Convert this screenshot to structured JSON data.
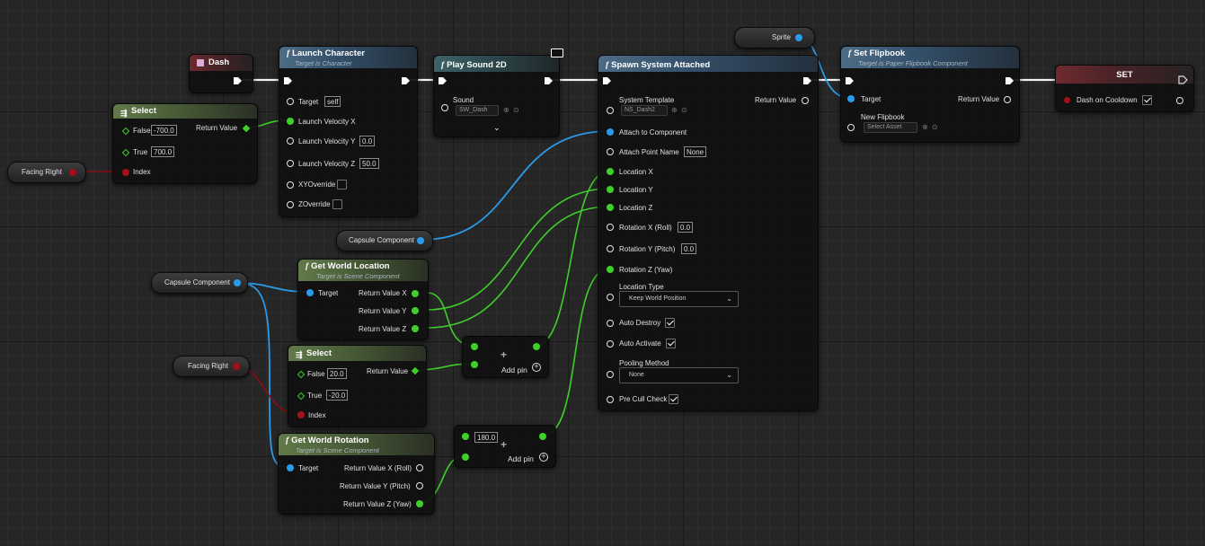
{
  "colors": {
    "exec": "#ffffff",
    "object": "#2a9be8",
    "float": "#3fcf2a",
    "bool": "#a3101a",
    "name": "#d0b8f0",
    "enum": "#4a6a70"
  },
  "nodes": {
    "dash_event": {
      "title": "Dash"
    },
    "select1": {
      "title": "Select",
      "false_label": "False",
      "false_value": "-700.0",
      "true_label": "True",
      "true_value": "700.0",
      "index_label": "Index",
      "return_label": "Return Value"
    },
    "facing_right_1": {
      "label": "Facing Right"
    },
    "launch": {
      "title": "Launch Character",
      "subtitle": "Target is Character",
      "target_label": "Target",
      "target_value": "self",
      "vx": "Launch Velocity X",
      "vy": "Launch Velocity Y",
      "vy_value": "0.0",
      "vz": "Launch Velocity Z",
      "vz_value": "50.0",
      "xy": "XYOverride",
      "z": "ZOverride"
    },
    "sound": {
      "title": "Play Sound 2D",
      "sound_label": "Sound",
      "sound_value": "SW_Dash"
    },
    "spawn": {
      "title": "Spawn System Attached",
      "template_label": "System Template",
      "template_value": "NS_Dash2",
      "return_label": "Return Value",
      "attach_comp": "Attach to Component",
      "attach_point": "Attach Point Name",
      "attach_point_value": "None",
      "lx": "Location X",
      "ly": "Location Y",
      "lz": "Location Z",
      "rx": "Rotation X (Roll)",
      "rx_value": "0.0",
      "ry": "Rotation Y (Pitch)",
      "ry_value": "0.0",
      "rz": "Rotation Z (Yaw)",
      "loc_type": "Location Type",
      "loc_type_value": "Keep World Position",
      "auto_destroy": "Auto Destroy",
      "auto_activate": "Auto Activate",
      "pooling": "Pooling Method",
      "pooling_value": "None",
      "pre_cull": "Pre Cull Check"
    },
    "sprite": {
      "label": "Sprite"
    },
    "flipbook": {
      "title": "Set Flipbook",
      "subtitle": "Target is Paper Flipbook Component",
      "target_label": "Target",
      "return_label": "Return Value",
      "new_label": "New Flipbook",
      "new_value": "Select Asset"
    },
    "set": {
      "title": "SET",
      "var_label": "Dash on Cooldown"
    },
    "capsule1": {
      "label": "Capsule Component"
    },
    "capsule2": {
      "label": "Capsule Component"
    },
    "gwl": {
      "title": "Get World Location",
      "subtitle": "Target is Scene Component",
      "target_label": "Target",
      "rx": "Return Value X",
      "ry": "Return Value Y",
      "rz": "Return Value Z"
    },
    "select2": {
      "title": "Select",
      "false_label": "False",
      "false_value": "20.0",
      "true_label": "True",
      "true_value": "-20.0",
      "index_label": "Index",
      "return_label": "Return Value"
    },
    "facing_right_2": {
      "label": "Facing Right"
    },
    "add1": {
      "plus": "+",
      "add_pin": "Add pin"
    },
    "add2": {
      "plus": "+",
      "add_pin": "Add pin",
      "value": "180.0"
    },
    "gwr": {
      "title": "Get World Rotation",
      "subtitle": "Target is Scene Component",
      "target_label": "Target",
      "rx": "Return Value X (Roll)",
      "ry": "Return Value Y (Pitch)",
      "rz": "Return Value Z (Yaw)"
    }
  }
}
